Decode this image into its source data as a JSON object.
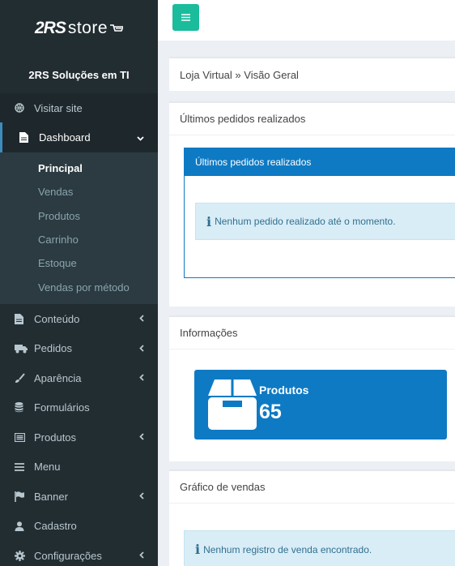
{
  "brand": {
    "logo_bold": "2RS",
    "logo_light": "store",
    "company": "2RS Soluções em TI"
  },
  "sidebar": {
    "visit": "Visitar site",
    "dashboard": "Dashboard",
    "dashboard_sub": [
      "Principal",
      "Vendas",
      "Produtos",
      "Carrinho",
      "Estoque",
      "Vendas por método"
    ],
    "items": [
      {
        "label": "Conteúdo"
      },
      {
        "label": "Pedidos"
      },
      {
        "label": "Aparência"
      },
      {
        "label": "Formulários"
      },
      {
        "label": "Produtos"
      },
      {
        "label": "Menu"
      },
      {
        "label": "Banner"
      },
      {
        "label": "Cadastro"
      },
      {
        "label": "Configurações"
      }
    ]
  },
  "breadcrumb": "Loja Virtual » Visão Geral",
  "orders": {
    "title": "Últimos pedidos realizados",
    "panel_title": "Últimos pedidos realizados",
    "empty_message": "Nenhum pedido realizado até o momento."
  },
  "info": {
    "title": "Informações",
    "products_label": "Produtos",
    "products_count": "65"
  },
  "sales_chart": {
    "title": "Gráfico de vendas",
    "empty_message": "Nenhum registro de venda encontrado."
  },
  "colors": {
    "sidebar_bg": "#222d32",
    "accent_blue": "#0e7ac4",
    "toggle_green": "#1abc9c",
    "alert_bg": "#d9edf7"
  }
}
